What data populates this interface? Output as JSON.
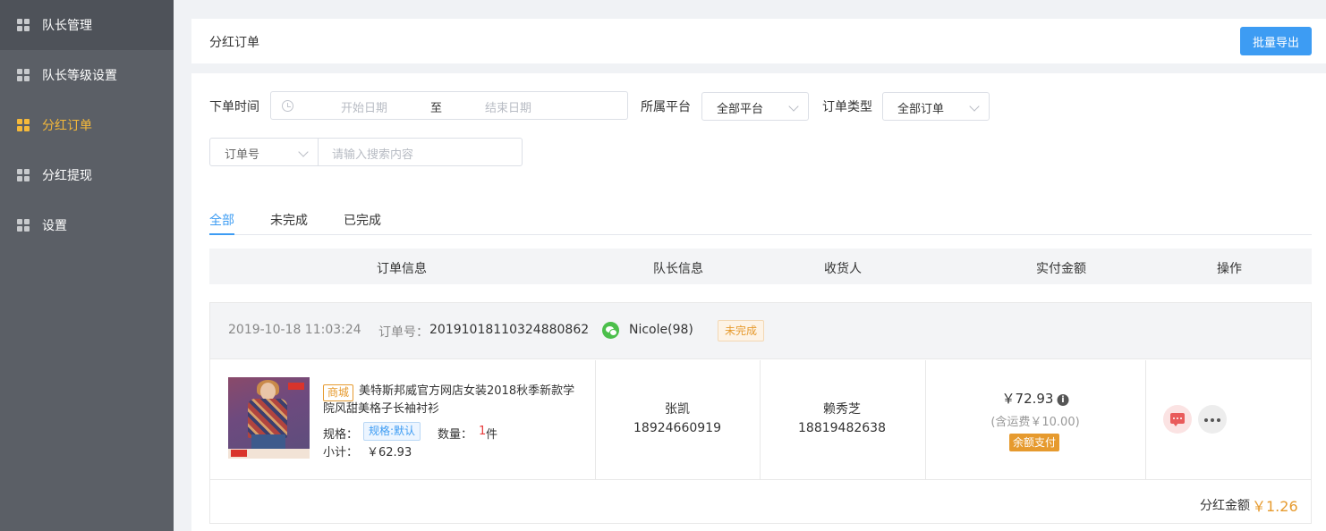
{
  "sidebar": {
    "items": [
      {
        "label": "队长管理"
      },
      {
        "label": "队长等级设置"
      },
      {
        "label": "分红订单"
      },
      {
        "label": "分红提现"
      },
      {
        "label": "设置"
      }
    ],
    "active_index": 2
  },
  "header": {
    "title": "分红订单",
    "export_label": "批量导出"
  },
  "filters": {
    "order_time_label": "下单时间",
    "start_placeholder": "开始日期",
    "range_sep": "至",
    "end_placeholder": "结束日期",
    "platform_label": "所属平台",
    "platform_value": "全部平台",
    "type_label": "订单类型",
    "type_value": "全部订单",
    "search_field_value": "订单号",
    "search_placeholder": "请输入搜索内容"
  },
  "tabs": [
    {
      "label": "全部"
    },
    {
      "label": "未完成"
    },
    {
      "label": "已完成"
    }
  ],
  "table": {
    "headers": [
      "订单信息",
      "队长信息",
      "收货人",
      "实付金额",
      "操作"
    ]
  },
  "order": {
    "time": "2019-10-18 11:03:24",
    "order_no_label": "订单号：",
    "order_no": "20191018110324880862",
    "captain": "Nicole(98)",
    "status": "未完成",
    "product": {
      "badge": "商城",
      "title": "美特斯邦威官方网店女装2018秋季新款学院风甜美格子长袖衬衫",
      "spec_label": "规格：",
      "spec_value": "规格:默认",
      "qty_label": "数量：",
      "qty": "1",
      "qty_unit": "件",
      "subtotal_label": "小计：",
      "subtotal": "￥62.93"
    },
    "captain_info": {
      "name": "张凯",
      "phone": "18924660919"
    },
    "receiver": {
      "name": "赖秀芝",
      "phone": "18819482638"
    },
    "payment": {
      "amount": "￥72.93",
      "shipping": "(含运费￥10.00)",
      "method": "余额支付"
    },
    "bonus_label": "分红金额",
    "bonus": "￥1.26"
  },
  "colors": {
    "accent": "#3d9cf3",
    "active_menu": "#f5b93a",
    "warning": "#e69a2e"
  }
}
